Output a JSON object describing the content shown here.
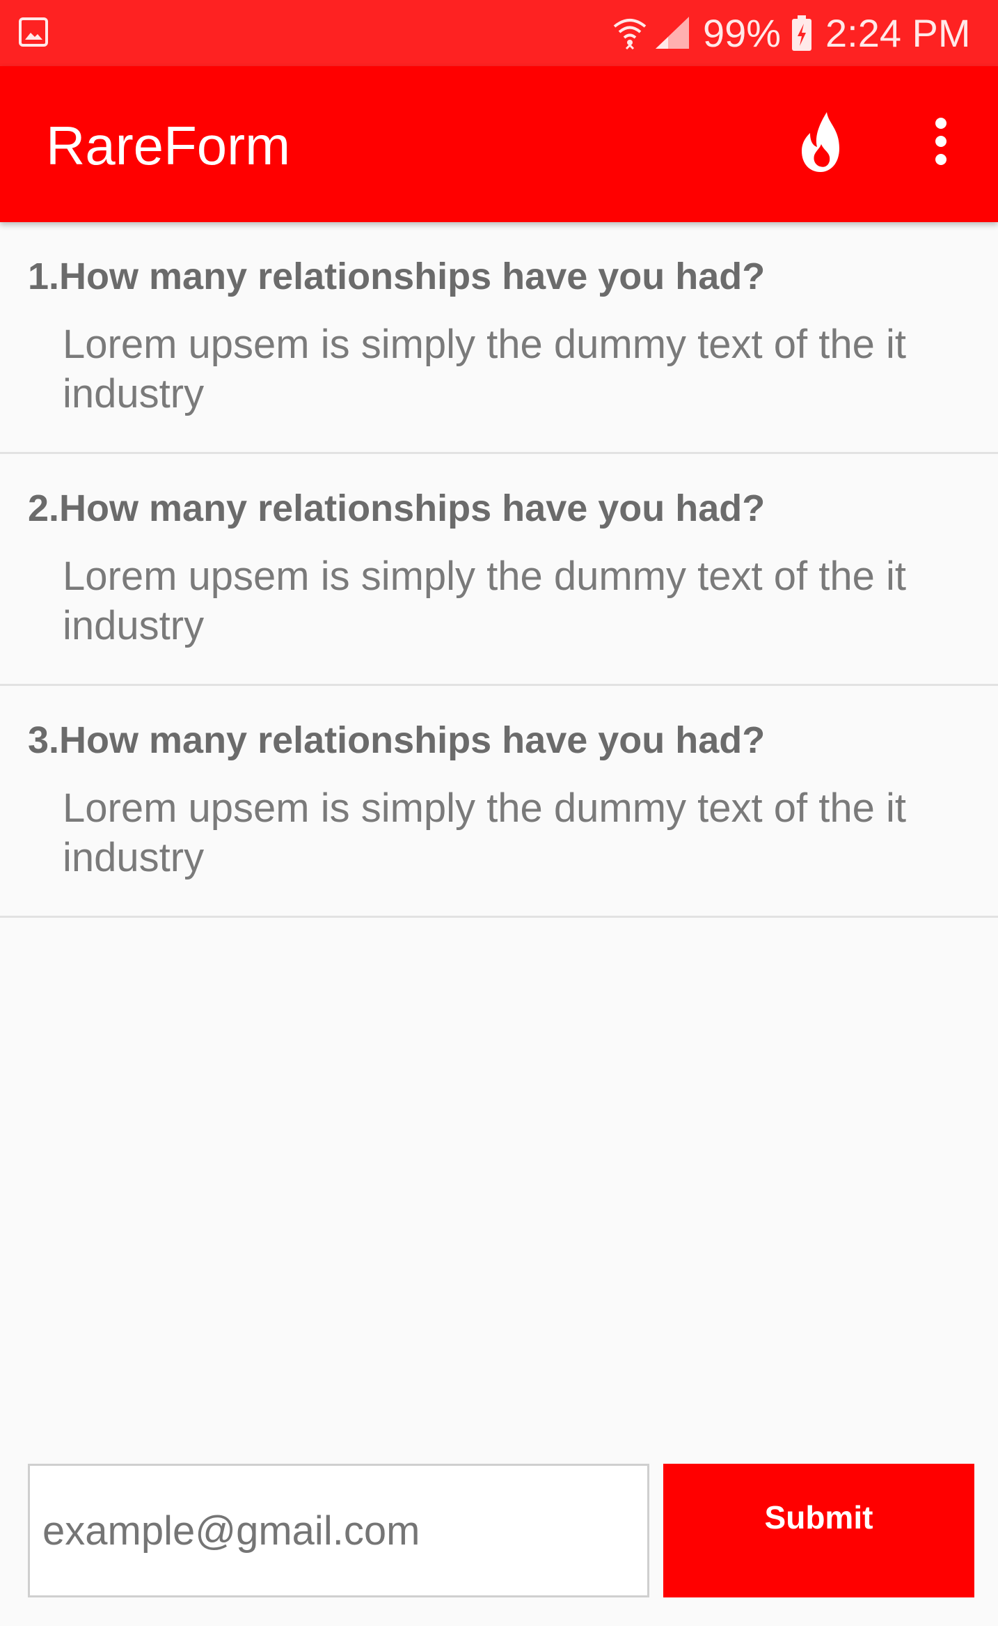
{
  "status_bar": {
    "battery": "99%",
    "time": "2:24 PM",
    "icons": [
      "gallery-icon",
      "wifi-icon",
      "signal-icon",
      "battery-charging-icon"
    ]
  },
  "app_bar": {
    "title": "RareForm",
    "actions": [
      "fire-icon",
      "more-vert-icon"
    ]
  },
  "questions": [
    {
      "title": "1.How many relationships have you had?",
      "description": "Lorem upsem is simply the dummy text of the it industry"
    },
    {
      "title": "2.How many relationships have you had?",
      "description": "Lorem upsem is simply the dummy text of the it industry"
    },
    {
      "title": "3.How many relationships have you had?",
      "description": "Lorem upsem is simply the dummy text of the it industry"
    }
  ],
  "form": {
    "email_placeholder": "example@gmail.com",
    "submit_label": "Submit"
  },
  "colors": {
    "status_bar": "#fe2222",
    "app_bar": "#ff0000",
    "submit": "#ff0000",
    "background": "#fafafa"
  }
}
